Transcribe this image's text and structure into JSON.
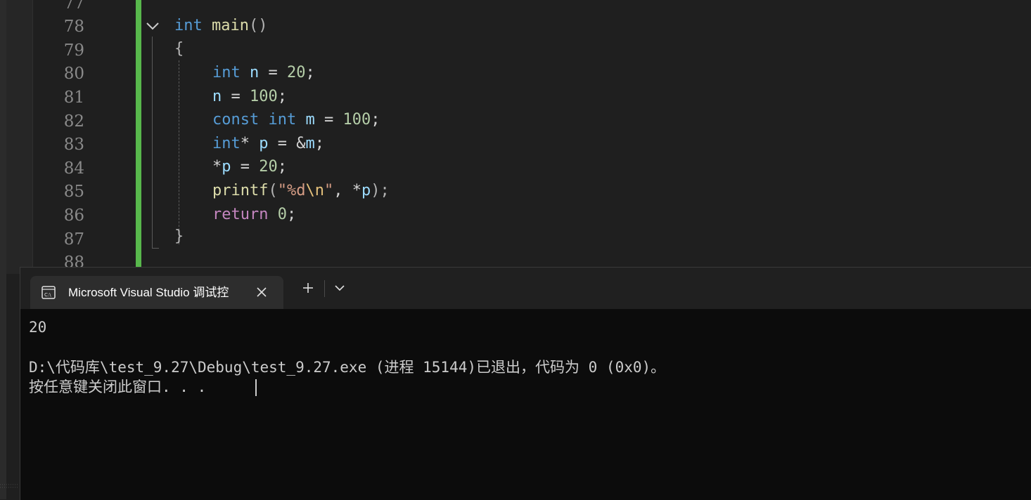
{
  "editor": {
    "line_numbers": [
      "77",
      "78",
      "79",
      "80",
      "81",
      "82",
      "83",
      "84",
      "85",
      "86",
      "87",
      "88"
    ],
    "code_lines": [
      {
        "line": "78",
        "text": "int main()"
      },
      {
        "line": "79",
        "text": "{"
      },
      {
        "line": "80",
        "text": "int n = 20;"
      },
      {
        "line": "81",
        "text": "n = 100;"
      },
      {
        "line": "82",
        "text": "const int m = 100;"
      },
      {
        "line": "83",
        "text": "int* p = &m;"
      },
      {
        "line": "84",
        "text": "*p = 20;"
      },
      {
        "line": "85",
        "text": "printf(\"%d\\n\", *p);"
      },
      {
        "line": "86",
        "text": "return 0;"
      },
      {
        "line": "87",
        "text": "}"
      }
    ],
    "tokens": {
      "l78": {
        "kw": "int",
        "fn": "main",
        "rest": "()"
      },
      "l79": {
        "brace": "{"
      },
      "l80": {
        "kw": "int",
        "var": "n",
        "op": " = ",
        "num": "20",
        "end": ";"
      },
      "l81": {
        "var": "n",
        "op": " = ",
        "num": "100",
        "end": ";"
      },
      "l82": {
        "kw1": "const",
        "kw2": "int",
        "var": "m",
        "op": " = ",
        "num": "100",
        "end": ";"
      },
      "l83": {
        "kw": "int",
        "op1": "* ",
        "var": "p",
        "op2": " = &",
        "var2": "m",
        "end": ";"
      },
      "l84": {
        "op1": "*",
        "var": "p",
        "op2": " = ",
        "num": "20",
        "end": ";"
      },
      "l85": {
        "fn": "printf",
        "p1": "(",
        "q1": "\"",
        "s1": "%d",
        "esc": "\\n",
        "q2": "\"",
        "p2": ", *",
        "var": "p",
        "p3": ");"
      },
      "l86": {
        "kw": "return",
        "num": "0",
        "end": ";"
      },
      "l87": {
        "brace": "}"
      }
    },
    "colors": {
      "change_bar": "#58b84c",
      "keyword": "#569cd6",
      "control": "#c586c0",
      "function": "#dcdcaa",
      "variable": "#9cdcfe",
      "number": "#b5cea8",
      "string": "#d69d85"
    }
  },
  "terminal": {
    "tab_title": "Microsoft Visual Studio 调试控",
    "tab_icon": "console-icon",
    "output": [
      "20",
      "",
      "D:\\代码库\\test_9.27\\Debug\\test_9.27.exe (进程 15144)已退出，代码为 0 (0x0)。",
      "按任意键关闭此窗口. . ."
    ]
  }
}
